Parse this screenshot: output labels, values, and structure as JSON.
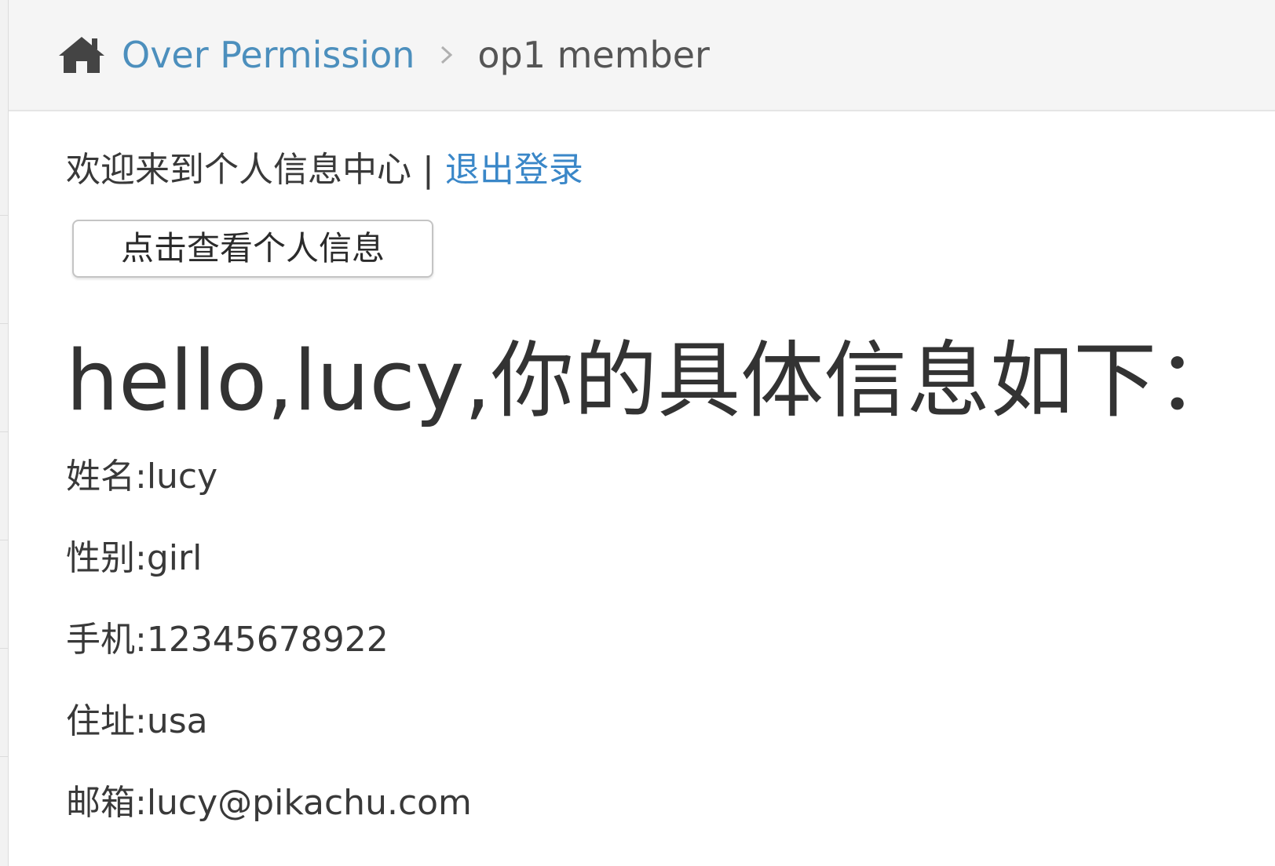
{
  "breadcrumb": {
    "home_icon": "home-icon",
    "parent": "Over Permission",
    "separator_icon": "chevron-right-icon",
    "current": "op1 member"
  },
  "welcome": {
    "text": "欢迎来到个人信息中心",
    "divider": "|",
    "logout": "退出登录"
  },
  "view_button_label": "点击查看个人信息",
  "greeting": "hello,lucy,你的具体信息如下：",
  "info": [
    "姓名:lucy",
    "性别:girl",
    "手机:12345678922",
    "住址:usa",
    "邮箱:lucy@pikachu.com"
  ],
  "colors": {
    "link": "#4c8fbd",
    "logout_link": "#3a87c8",
    "text": "#393939",
    "header_bg": "#f5f5f5"
  }
}
